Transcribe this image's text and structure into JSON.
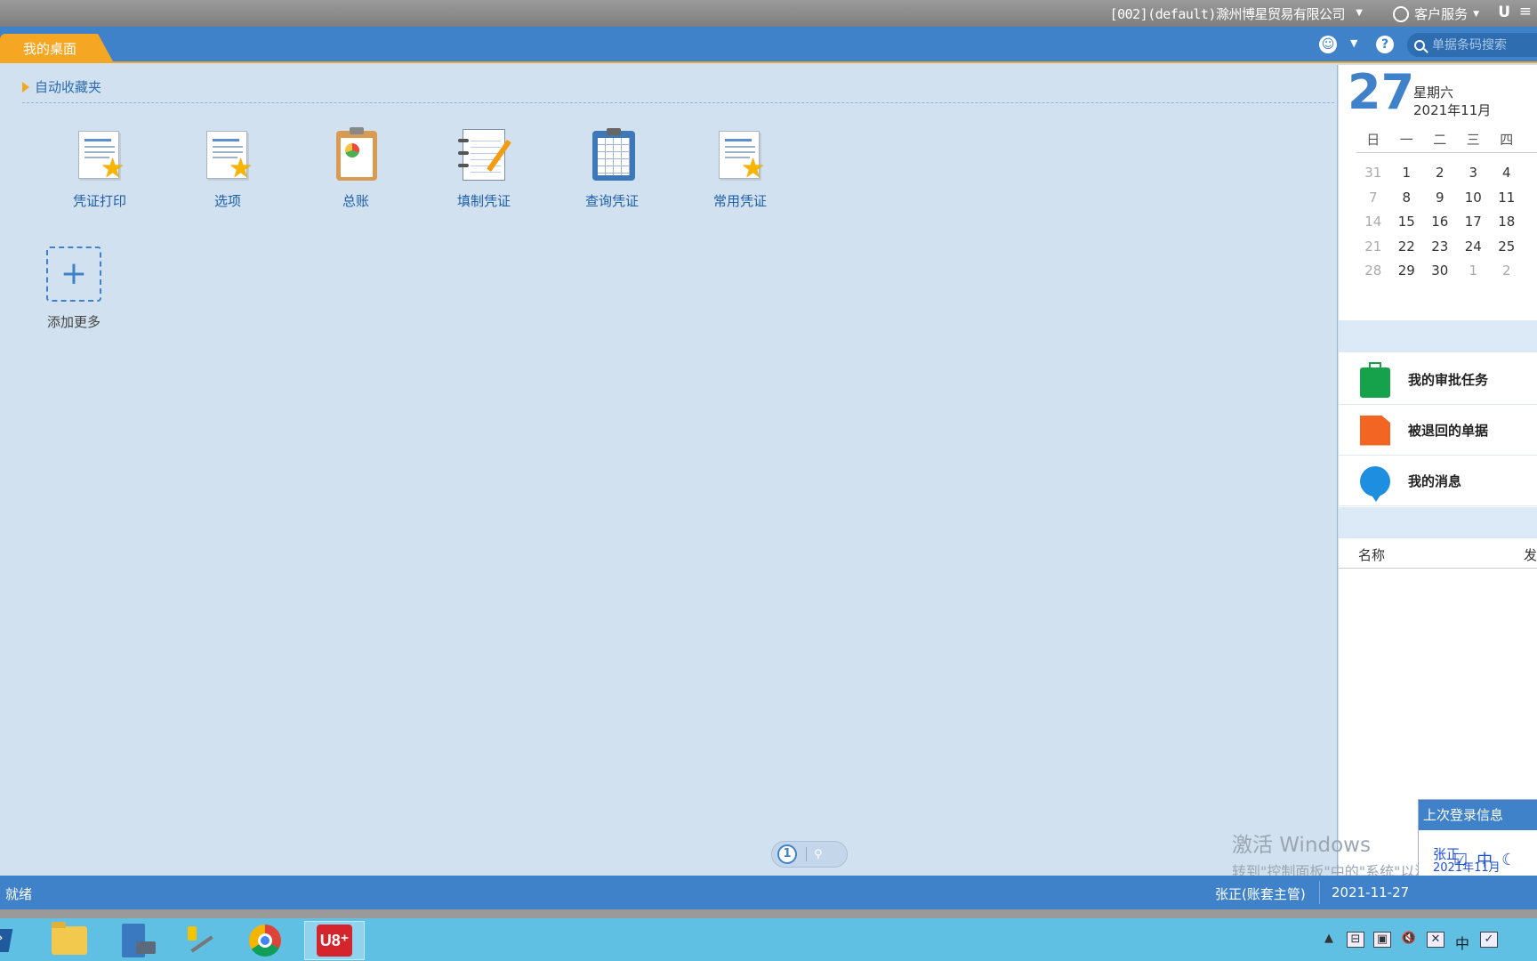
{
  "topbar": {
    "company": "[002](default)滁州博星贸易有限公司",
    "customer_service": "客户服务",
    "u_label": "U"
  },
  "tabbar": {
    "active_tab": "我的桌面",
    "search_placeholder": "单据条码搜索"
  },
  "favorites": {
    "header": "自动收藏夹",
    "tiles": [
      {
        "label": "凭证打印",
        "icon": "voucher-print-icon"
      },
      {
        "label": "选项",
        "icon": "options-icon"
      },
      {
        "label": "总账",
        "icon": "general-ledger-icon"
      },
      {
        "label": "填制凭证",
        "icon": "fill-voucher-icon"
      },
      {
        "label": "查询凭证",
        "icon": "query-voucher-icon"
      },
      {
        "label": "常用凭证",
        "icon": "common-voucher-icon"
      }
    ],
    "add_more": "添加更多"
  },
  "pager": {
    "current_page": "1"
  },
  "watermark": {
    "line1": "激活 Windows",
    "line2": "转到\"控制面板\"中的\"系统\"以激活 Windows。"
  },
  "calendar": {
    "day": "27",
    "weekday": "星期六",
    "year_month": "2021年11月",
    "headers": [
      "日",
      "一",
      "二",
      "三",
      "四"
    ],
    "weeks": [
      [
        "31",
        "1",
        "2",
        "3",
        "4"
      ],
      [
        "7",
        "8",
        "9",
        "10",
        "11"
      ],
      [
        "14",
        "15",
        "16",
        "17",
        "18"
      ],
      [
        "21",
        "22",
        "23",
        "24",
        "25"
      ],
      [
        "28",
        "29",
        "30",
        "1",
        "2"
      ]
    ]
  },
  "tasks": [
    {
      "label": "我的审批任务",
      "icon": "briefcase-icon",
      "color": "#15a24a"
    },
    {
      "label": "被退回的单据",
      "icon": "document-icon",
      "color": "#f26522"
    },
    {
      "label": "我的消息",
      "icon": "chat-bubble-icon",
      "color": "#1e8fe0"
    }
  ],
  "list_columns": {
    "name": "名称",
    "sender": "发"
  },
  "login_info": {
    "title": "上次登录信息",
    "line1": "张正",
    "line2": "2021年11月"
  },
  "statusbar": {
    "ready": "就绪",
    "user": "张正(账套主管)",
    "date": "2021-11-27"
  },
  "ime": {
    "mode": "中"
  },
  "colors": {
    "accent_blue": "#3f82c9",
    "tab_orange": "#f5a623",
    "workspace_bg": "#d1e1ef"
  }
}
